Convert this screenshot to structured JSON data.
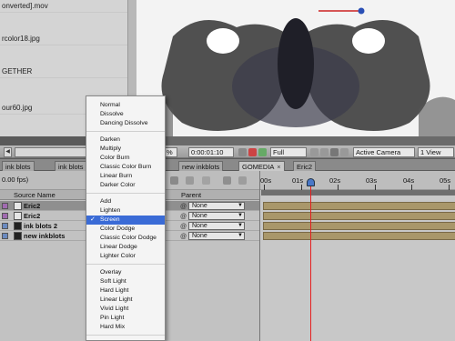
{
  "project_panel": {
    "items": [
      "onverted].mov",
      "rcolor18.jpg",
      "GETHER",
      "our60.jpg"
    ]
  },
  "viewer_toolbar": {
    "zoom": "%",
    "timecode": "0:00:01:10",
    "resolution": "Full",
    "camera": "Active Camera",
    "view": "1 View"
  },
  "tabs": [
    {
      "label": "ink blots",
      "active": false
    },
    {
      "label": "ink blots",
      "active": false
    },
    {
      "label": "new inkblots",
      "active": false
    },
    {
      "label": "GOMEDIA",
      "active": true
    },
    {
      "label": "Eric2",
      "active": false
    }
  ],
  "timeline": {
    "fps": "0.00 fps)",
    "columns": {
      "source_name": "Source Name",
      "parent": "Parent"
    },
    "layers": [
      {
        "name": "Eric2",
        "parent": "None",
        "selected": true
      },
      {
        "name": "Eric2",
        "parent": "None",
        "selected": false
      },
      {
        "name": "ink blots 2",
        "parent": "None",
        "selected": false
      },
      {
        "name": "new inkblots",
        "parent": "None",
        "selected": false
      }
    ],
    "ruler": [
      "00s",
      "01s",
      "02s",
      "03s",
      "04s",
      "05s"
    ],
    "colors": {
      "playhead": "#e52020",
      "track": "#a9976a",
      "selection": "#3a6bd6"
    }
  },
  "blend_menu": {
    "items": [
      "Normal",
      "Dissolve",
      "Dancing Dissolve",
      "Darken",
      "Multiply",
      "Color Burn",
      "Classic Color Burn",
      "Linear Burn",
      "Darker Color",
      "Add",
      "Lighten",
      "Screen",
      "Color Dodge",
      "Classic Color Dodge",
      "Linear Dodge",
      "Lighter Color",
      "Overlay",
      "Soft Light",
      "Hard Light",
      "Linear Light",
      "Vivid Light",
      "Pin Light",
      "Hard Mix"
    ],
    "selected": "Screen",
    "check_mark": "✓"
  },
  "icons": {
    "close": "×",
    "dropdown": "▼",
    "arrow_left": "◀",
    "arrow_right": "▶"
  }
}
